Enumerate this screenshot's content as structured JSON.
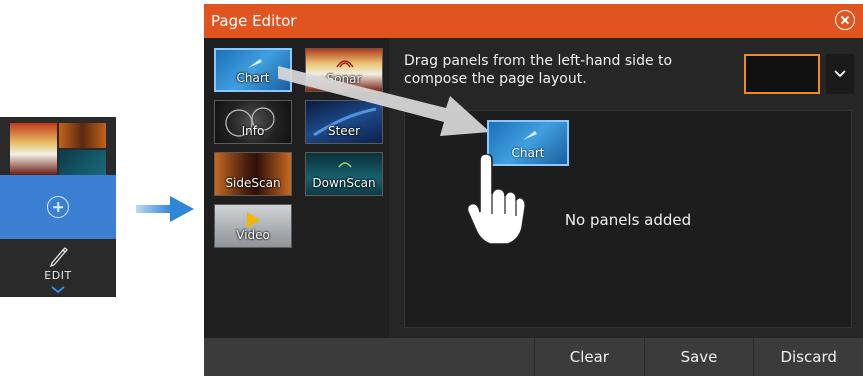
{
  "sidebar": {
    "edit_label": "EDIT"
  },
  "dialog": {
    "title": "Page Editor",
    "instruction": "Drag panels from the left-hand side to compose the page layout.",
    "empty_message": "No panels added",
    "dragged_panel_label": "Chart"
  },
  "panels": [
    {
      "label": "Chart",
      "icon": "chart-icon"
    },
    {
      "label": "Sonar",
      "icon": "sonar-icon"
    },
    {
      "label": "Info",
      "icon": "gauge-icon"
    },
    {
      "label": "Steer",
      "icon": "steer-icon"
    },
    {
      "label": "SideScan",
      "icon": "sidescan-icon"
    },
    {
      "label": "DownScan",
      "icon": "downscan-icon"
    },
    {
      "label": "Video",
      "icon": "play-icon"
    }
  ],
  "footer": {
    "clear_label": "Clear",
    "save_label": "Save",
    "discard_label": "Discard"
  },
  "colors": {
    "title_bar": "#e2541f",
    "accent_blue": "#3a7fd1",
    "layout_select_border": "#f08a1c"
  }
}
